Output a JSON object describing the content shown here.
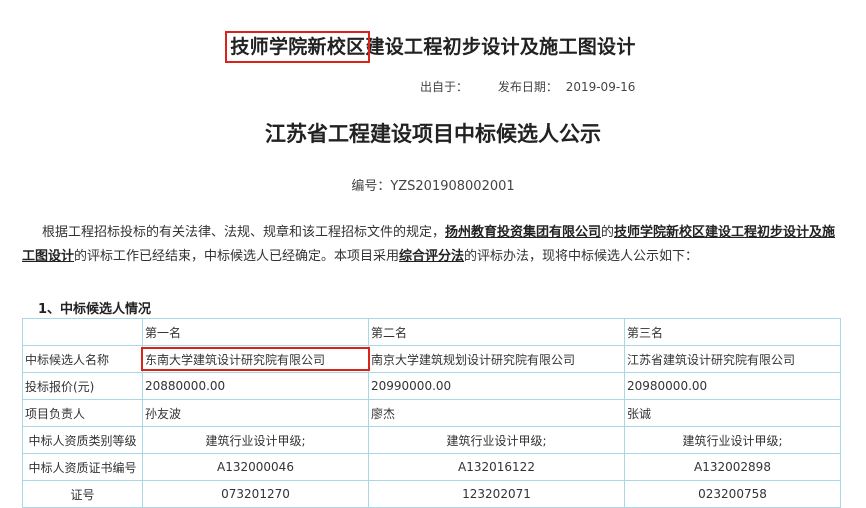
{
  "header": {
    "title_highlight": "技师学院新校区",
    "title_rest": "建设工程初步设计及施工图设计",
    "source_label": "出自于：",
    "date_label": "发布日期：",
    "date_value": "2019-09-16"
  },
  "notice": {
    "title": "江苏省工程建设项目中标候选人公示",
    "serial": "编号：YZS201908002001"
  },
  "intro": {
    "p1": "根据工程招标投标的有关法律、法规、规章和该工程招标文件的规定，",
    "org": "扬州教育投资集团有限公司",
    "p2": "的",
    "project": "技师学院新校区建设工程初步设计及施工图设计",
    "p3": "的评标工作已经结束，中标候选人已经确定。本项目采用",
    "method": "综合评分法",
    "p4": "的评标办法，现将中标候选人公示如下："
  },
  "section1": {
    "heading": "1、中标候选人情况"
  },
  "table": {
    "header_row": [
      "",
      "第一名",
      "第二名",
      "第三名"
    ],
    "rows": [
      {
        "label": "中标候选人名称",
        "values": [
          "东南大学建筑设计研究院有限公司",
          "南京大学建筑规划设计研究院有限公司",
          "江苏省建筑设计研究院有限公司"
        ]
      },
      {
        "label": "投标报价(元)",
        "values": [
          "20880000.00",
          "20990000.00",
          "20980000.00"
        ]
      },
      {
        "label": "项目负责人",
        "values": [
          "孙友波",
          "廖杰",
          "张诚"
        ]
      },
      {
        "label": "中标人资质类别等级",
        "values": [
          "建筑行业设计甲级;",
          "建筑行业设计甲级;",
          "建筑行业设计甲级;"
        ]
      },
      {
        "label": "中标人资质证书编号",
        "values": [
          "A132000046",
          "A132016122",
          "A132002898"
        ]
      },
      {
        "label": "证号",
        "values": [
          "073201270",
          "123202071",
          "023200758"
        ]
      }
    ]
  },
  "colors": {
    "highlight_border": "#d9241c",
    "table_border": "#a9d6e8"
  }
}
